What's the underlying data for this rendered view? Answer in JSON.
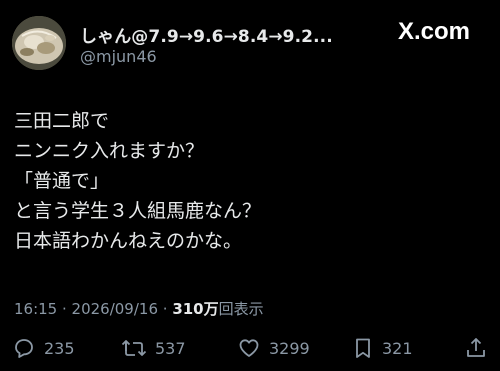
{
  "author": {
    "display_name": "しゃん@7.9→9.6→8.4→9.2...",
    "handle": "@mjun46",
    "avatar_icon": "profile-photo"
  },
  "brand": {
    "label": "X.com",
    "icon": "x-logo-icon"
  },
  "post": {
    "lines": [
      "三田二郎で",
      "ニンニク入れますか？",
      "「普通で」",
      "と言う学生３人組馬鹿なん？",
      "日本語わかんねえのかな。"
    ]
  },
  "meta": {
    "timestamp": "16:15 · 2026/09/16 ·",
    "views_count": "310万",
    "views_label": "回表示"
  },
  "actions": {
    "reply_count": "235",
    "repost_count": "537",
    "like_count": "3299",
    "bookmark_count": "321"
  },
  "colors": {
    "background": "#000000",
    "text": "#e7e9ea",
    "muted": "#8b98a5"
  }
}
